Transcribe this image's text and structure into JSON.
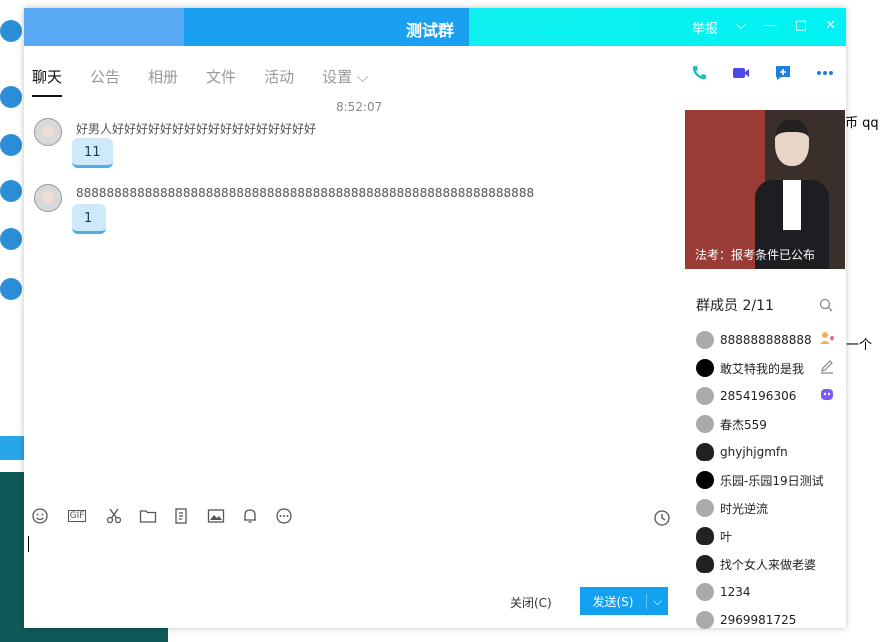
{
  "window": {
    "title": "测试群",
    "report_label": "举报",
    "min_glyph": "—",
    "max_glyph": "□",
    "close_glyph": "✕",
    "dropdown_glyph": "⌵"
  },
  "tabs": [
    {
      "label": "聊天"
    },
    {
      "label": "公告"
    },
    {
      "label": "相册"
    },
    {
      "label": "文件"
    },
    {
      "label": "活动"
    },
    {
      "label": "设置 ⌵"
    }
  ],
  "colors": {
    "accent": "#12a0f0",
    "phone": "#1fbfb8",
    "video": "#4a4ae8",
    "more": "#1a7fe0"
  },
  "chat": {
    "timestamp": "8:52:07",
    "messages": [
      {
        "sender": "好男人好好好好好好好好好好好好好好好好好",
        "text": "11"
      },
      {
        "sender": "888888888888888888888888888888888888888888888888888888888888",
        "text": "1"
      }
    ]
  },
  "toolbar": {
    "icons": [
      "emoji-icon",
      "gif-icon",
      "scissors-icon",
      "folder-icon",
      "document-icon",
      "image-icon",
      "bell-icon",
      "more-circle-icon",
      "history-clock-icon"
    ],
    "gif_label": "GIF"
  },
  "actions": {
    "close_label": "关闭(C)",
    "send_label": "发送(S)",
    "send_caret": "⌵"
  },
  "ad": {
    "caption": "法考：报考条件已公布"
  },
  "members": {
    "header": "群成员 2/11",
    "items": [
      {
        "name": "888888888888"
      },
      {
        "name": "敢艾特我的是我"
      },
      {
        "name": "2854196306"
      },
      {
        "name": "春杰559"
      },
      {
        "name": "ghyjhjgmfn"
      },
      {
        "name": "乐园-乐园19日测试"
      },
      {
        "name": "时光逆流"
      },
      {
        "name": "叶"
      },
      {
        "name": "找个女人来做老婆"
      },
      {
        "name": "1234"
      },
      {
        "name": "2969981725"
      }
    ]
  },
  "outside": {
    "text1": "币 qq",
    "text2": "一个"
  }
}
